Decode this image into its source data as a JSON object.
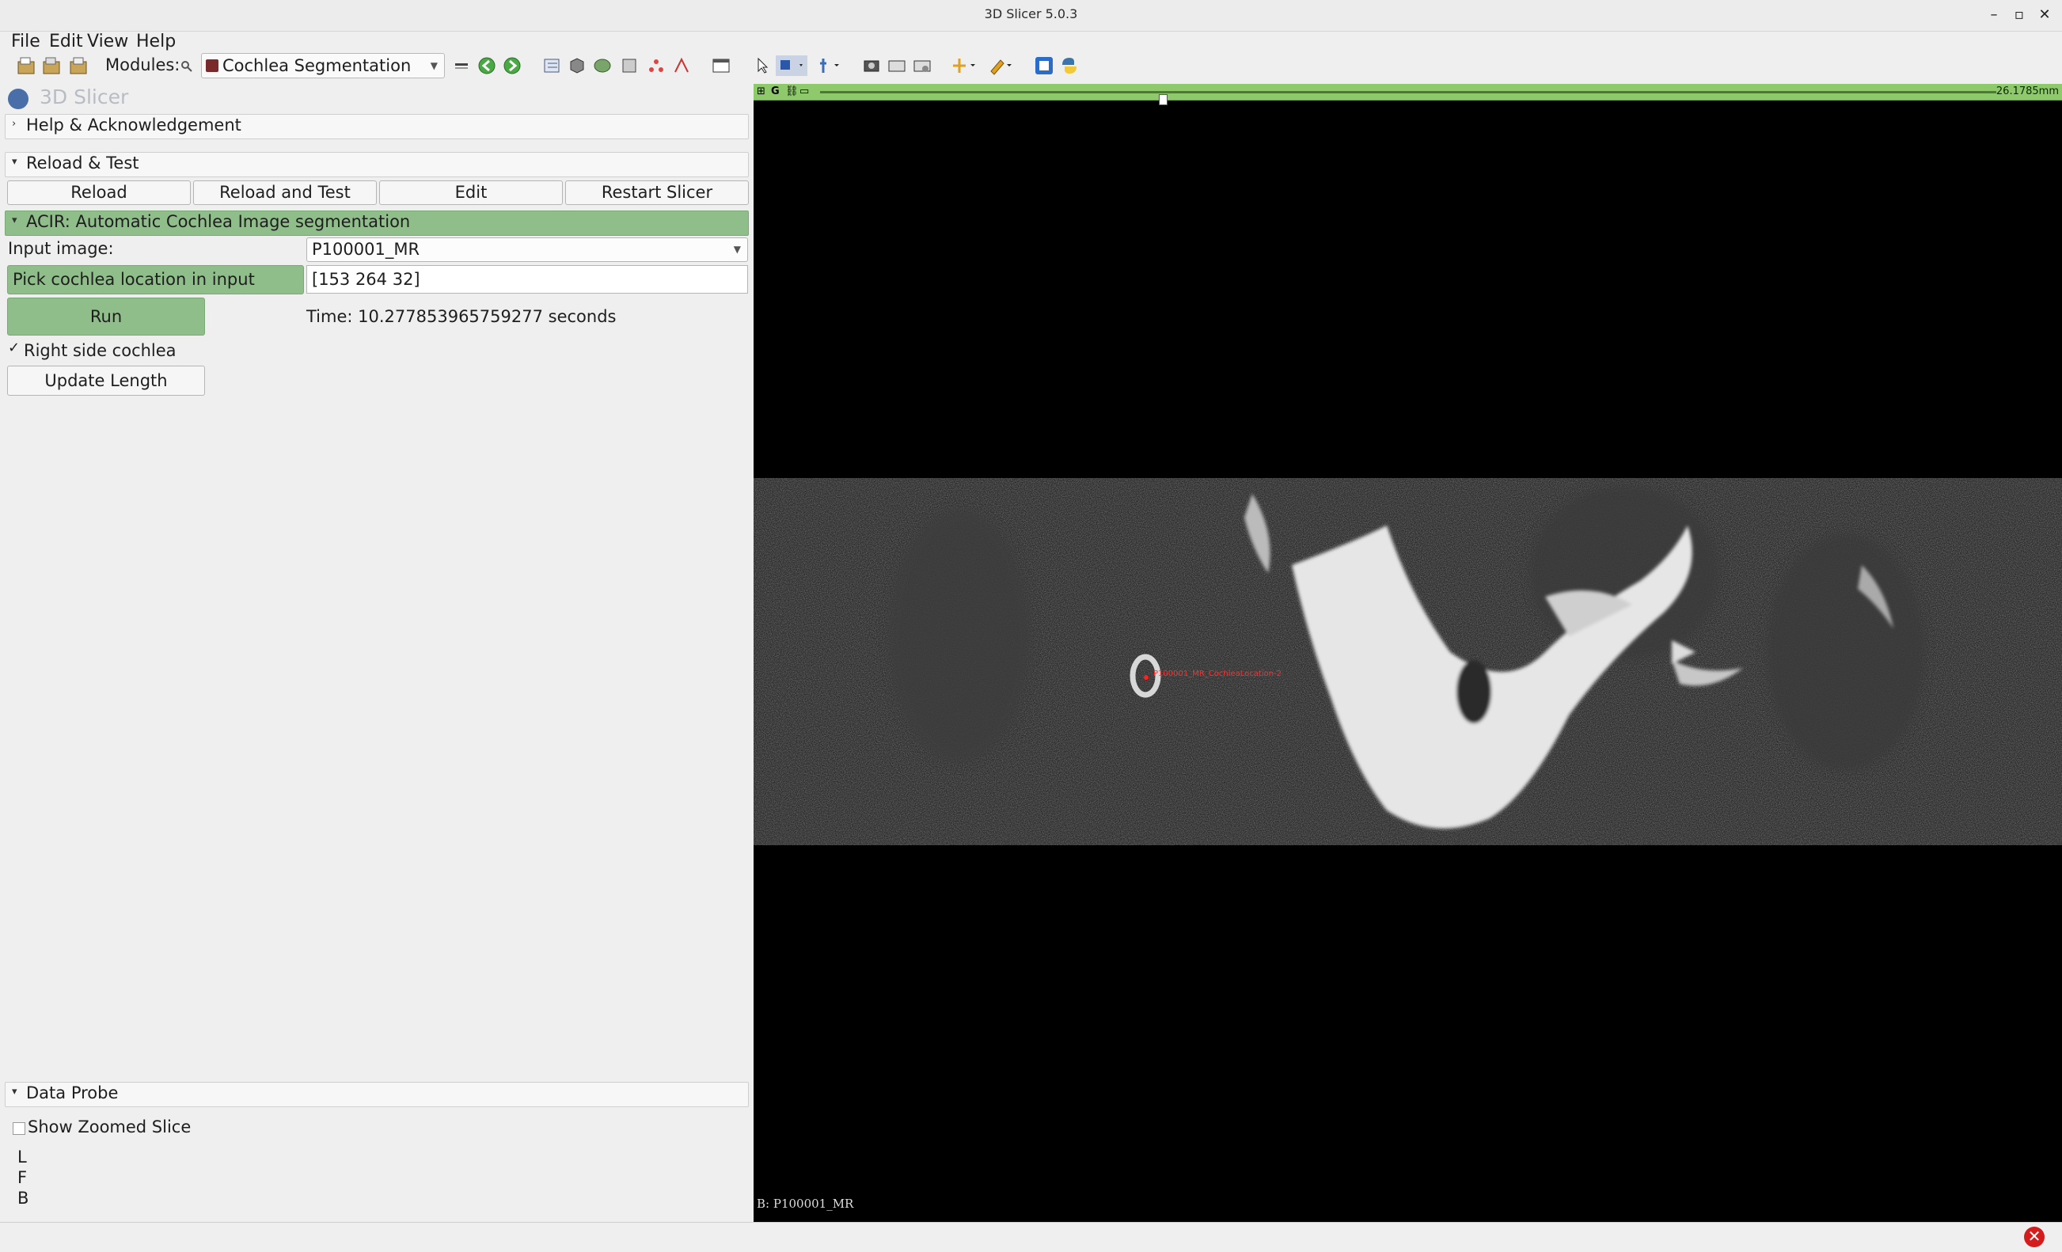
{
  "window": {
    "title": "3D Slicer 5.0.3",
    "minimize": "–",
    "maximize": "▫",
    "close": "✕"
  },
  "menu": [
    "File",
    "Edit",
    "View",
    "Help"
  ],
  "toolbar": {
    "modules_label": "Modules:",
    "selected_module": "Cochlea Segmentation"
  },
  "app_logo_text": "3D Slicer",
  "sections": {
    "help": "Help & Acknowledgement",
    "reload": "Reload & Test",
    "acir": "ACIR: Automatic Cochlea Image segmentation",
    "probe": "Data Probe"
  },
  "reload_buttons": [
    "Reload",
    "Reload and Test",
    "Edit",
    "Restart Slicer"
  ],
  "form": {
    "input_image_label": "Input image:",
    "input_image_value": "P100001_MR",
    "pick_location_button": "Pick cochlea location in input image",
    "location_value": "[153 264  32]",
    "run_button": "Run",
    "time_text": "Time: 10.277853965759277  seconds",
    "right_side_label": "Right side cochlea",
    "right_side_checked": true,
    "update_length_button": "Update Length"
  },
  "probe": {
    "show_zoomed_label": "Show Zoomed Slice",
    "show_zoomed_checked": false,
    "rows": [
      "L",
      "F",
      "B"
    ]
  },
  "viewer": {
    "bar_letter": "G",
    "fov_text": "26.1785mm",
    "slice_position": 0.291,
    "volume_label": "B: P100001_MR",
    "fiducial_label": "P100001_MR_CochleaLocation-2",
    "bar_color": "#8ec96c"
  }
}
